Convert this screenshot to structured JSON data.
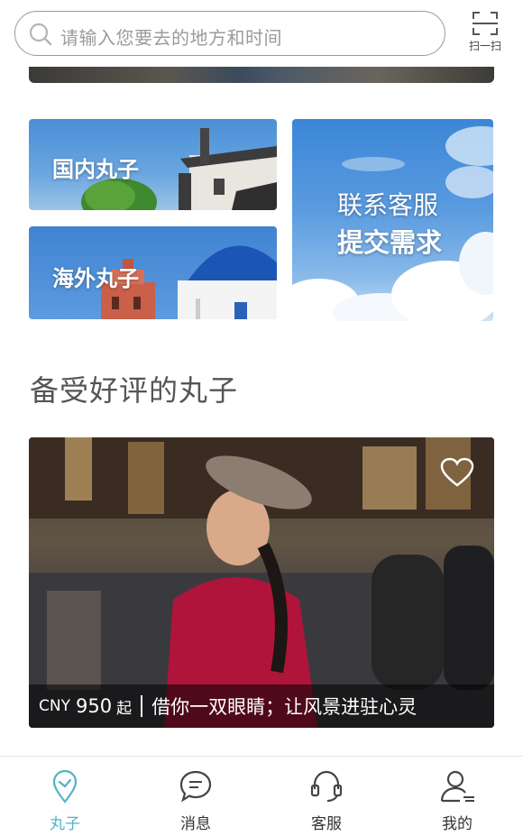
{
  "search": {
    "placeholder": "请输入您要去的地方和时间"
  },
  "scan": {
    "label": "扫一扫"
  },
  "categories": {
    "domestic": "国内丸子",
    "overseas": "海外丸子",
    "service_line1": "联系客服",
    "service_line2": "提交需求"
  },
  "section": {
    "title": "备受好评的丸子"
  },
  "featured": {
    "currency": "CNY",
    "price": "950",
    "price_suffix": "起",
    "title": "借你一双眼睛；让风景进驻心灵"
  },
  "tabs": [
    {
      "label": "丸子",
      "icon": "location-pin-icon",
      "active": true
    },
    {
      "label": "消息",
      "icon": "chat-bubble-icon",
      "active": false
    },
    {
      "label": "客服",
      "icon": "headset-icon",
      "active": false
    },
    {
      "label": "我的",
      "icon": "user-icon",
      "active": false
    }
  ],
  "colors": {
    "accent": "#52b3c4",
    "text": "#333333",
    "placeholder": "#9b9b9b"
  }
}
